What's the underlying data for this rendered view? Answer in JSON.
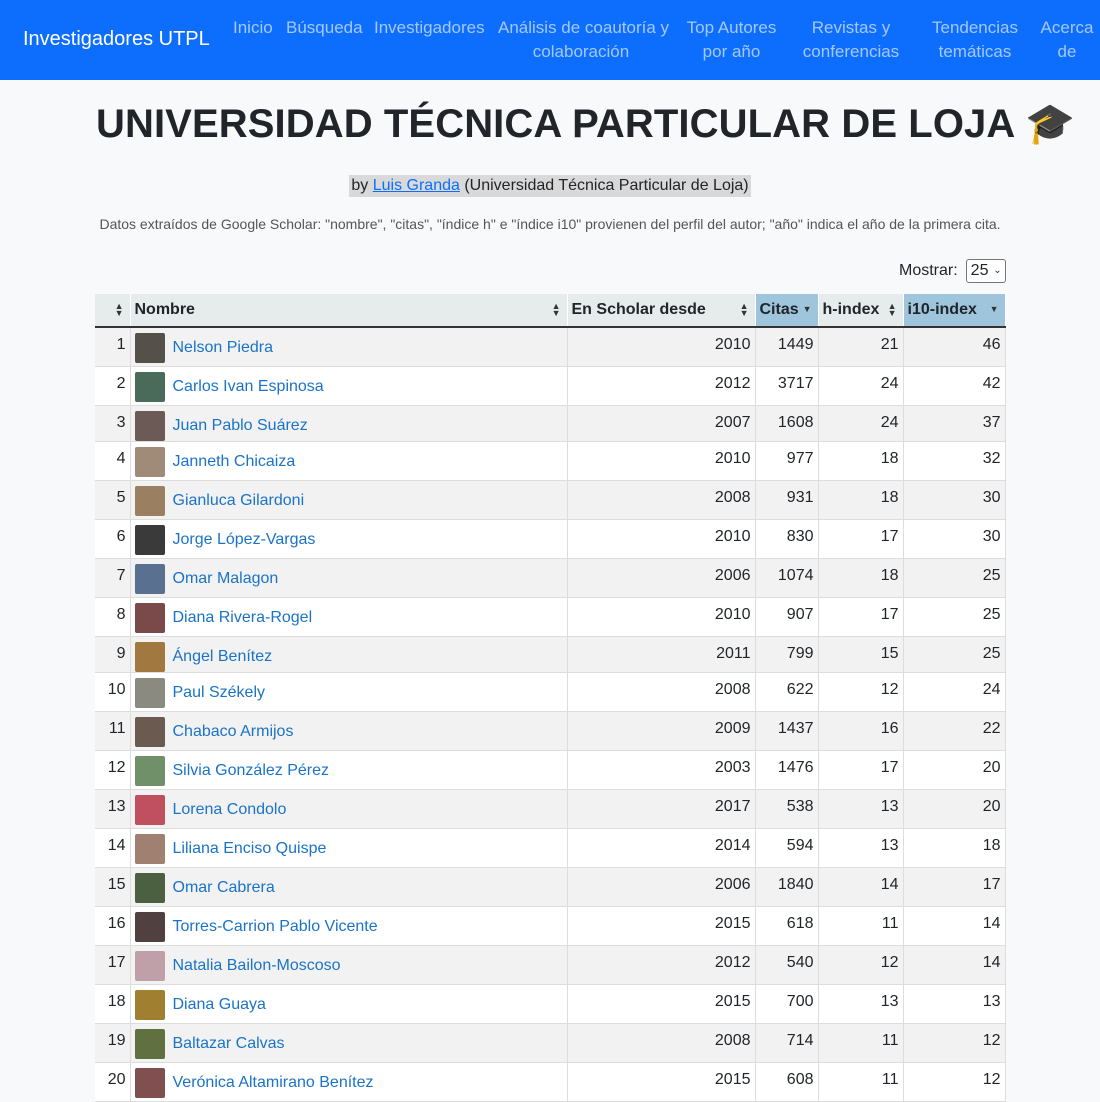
{
  "navbar": {
    "brand": "Investigadores UTPL",
    "items": [
      {
        "label": "Inicio"
      },
      {
        "label": "Búsqueda"
      },
      {
        "label": "Investigadores"
      },
      {
        "line1": "Análisis de coautoría y",
        "line2": "colaboración"
      },
      {
        "line1": "Top Autores",
        "line2": "por año"
      },
      {
        "line1": "Revistas y",
        "line2": "conferencias"
      },
      {
        "line1": "Tendencias",
        "line2": "temáticas"
      },
      {
        "line1": "Acerca",
        "line2": "de"
      }
    ]
  },
  "header": {
    "title": "UNIVERSIDAD TÉCNICA PARTICULAR DE LOJA 🎓",
    "by_prefix": "by",
    "author_link": "Luis Granda",
    "affiliation": "(Universidad Técnica Particular de Loja)",
    "note": "Datos extraídos de Google Scholar: \"nombre\", \"citas\", \"índice h\" e \"índice i10\" provienen del perfil del autor; \"año\" indica el año de la primera cita."
  },
  "show": {
    "label": "Mostrar:",
    "value": "25"
  },
  "table": {
    "columns": [
      "",
      "Nombre",
      "En Scholar desde",
      "Citas",
      "h-index",
      "i10-index"
    ],
    "rows": [
      {
        "idx": "1",
        "name": "Nelson Piedra",
        "since": "2010",
        "citas": "1449",
        "h": "21",
        "i10": "46",
        "avatar": "#55504a"
      },
      {
        "idx": "2",
        "name": "Carlos Ivan Espinosa",
        "since": "2012",
        "citas": "3717",
        "h": "24",
        "i10": "42",
        "avatar": "#4a6a5a"
      },
      {
        "idx": "3",
        "name": "Juan Pablo Suárez",
        "since": "2007",
        "citas": "1608",
        "h": "24",
        "i10": "37",
        "avatar": "#6b5a55"
      },
      {
        "idx": "4",
        "name": "Janneth Chicaiza",
        "since": "2010",
        "citas": "977",
        "h": "18",
        "i10": "32",
        "avatar": "#a08a78"
      },
      {
        "idx": "5",
        "name": "Gianluca Gilardoni",
        "since": "2008",
        "citas": "931",
        "h": "18",
        "i10": "30",
        "avatar": "#9a8060"
      },
      {
        "idx": "6",
        "name": "Jorge López-Vargas",
        "since": "2010",
        "citas": "830",
        "h": "17",
        "i10": "30",
        "avatar": "#3a3a3a"
      },
      {
        "idx": "7",
        "name": "Omar Malagon",
        "since": "2006",
        "citas": "1074",
        "h": "18",
        "i10": "25",
        "avatar": "#5a7090"
      },
      {
        "idx": "8",
        "name": "Diana Rivera-Rogel",
        "since": "2010",
        "citas": "907",
        "h": "17",
        "i10": "25",
        "avatar": "#7a4a4a"
      },
      {
        "idx": "9",
        "name": "Ángel Benítez",
        "since": "2011",
        "citas": "799",
        "h": "15",
        "i10": "25",
        "avatar": "#a07840"
      },
      {
        "idx": "10",
        "name": "Paul Székely",
        "since": "2008",
        "citas": "622",
        "h": "12",
        "i10": "24",
        "avatar": "#8a8a80"
      },
      {
        "idx": "11",
        "name": "Chabaco Armijos",
        "since": "2009",
        "citas": "1437",
        "h": "16",
        "i10": "22",
        "avatar": "#6a5a50"
      },
      {
        "idx": "12",
        "name": "Silvia González Pérez",
        "since": "2003",
        "citas": "1476",
        "h": "17",
        "i10": "20",
        "avatar": "#70906a"
      },
      {
        "idx": "13",
        "name": "Lorena Condolo",
        "since": "2017",
        "citas": "538",
        "h": "13",
        "i10": "20",
        "avatar": "#c05060"
      },
      {
        "idx": "14",
        "name": "Liliana Enciso Quispe",
        "since": "2014",
        "citas": "594",
        "h": "13",
        "i10": "18",
        "avatar": "#a08070"
      },
      {
        "idx": "15",
        "name": "Omar Cabrera",
        "since": "2006",
        "citas": "1840",
        "h": "14",
        "i10": "17",
        "avatar": "#4a6040"
      },
      {
        "idx": "16",
        "name": "Torres-Carrion Pablo Vicente",
        "since": "2015",
        "citas": "618",
        "h": "11",
        "i10": "14",
        "avatar": "#504040"
      },
      {
        "idx": "17",
        "name": "Natalia Bailon-Moscoso",
        "since": "2012",
        "citas": "540",
        "h": "12",
        "i10": "14",
        "avatar": "#c0a0a8"
      },
      {
        "idx": "18",
        "name": "Diana Guaya",
        "since": "2015",
        "citas": "700",
        "h": "13",
        "i10": "13",
        "avatar": "#a08030"
      },
      {
        "idx": "19",
        "name": "Baltazar Calvas",
        "since": "2008",
        "citas": "714",
        "h": "11",
        "i10": "12",
        "avatar": "#607040"
      },
      {
        "idx": "20",
        "name": "Verónica Altamirano Benítez",
        "since": "2015",
        "citas": "608",
        "h": "11",
        "i10": "12",
        "avatar": "#805050"
      }
    ]
  },
  "colors": {
    "navbar": "#0d6efd",
    "link": "#1a73c8",
    "sorted_header": "#9ec5dc"
  }
}
